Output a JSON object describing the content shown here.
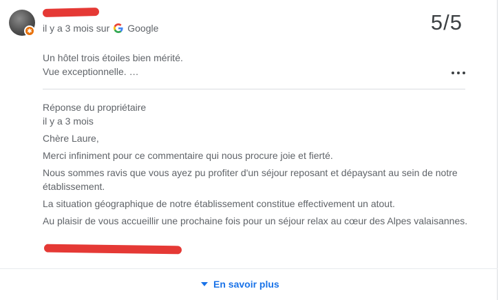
{
  "review": {
    "author_redacted": true,
    "meta": {
      "time": "il y a 3 mois sur",
      "source": "Google",
      "source_icon": "google-g-icon"
    },
    "rating": "5/5",
    "text_lines": [
      "Un hôtel trois étoiles bien mérité.",
      "Vue exceptionnelle. …"
    ],
    "more_icon": "more-horiz-icon"
  },
  "owner_reply": {
    "title": "Réponse du propriétaire",
    "time": "il y a 3 mois",
    "greeting": "Chère Laure,",
    "paragraphs": [
      "Merci infiniment pour ce commentaire qui nous procure joie et fierté.",
      "Nous sommes ravis que vous ayez pu profiter d'un séjour reposant et dépaysant au sein de notre établissement.",
      "La situation géographique de notre établissement constitue effectivement un atout.",
      "Au plaisir de vous accueillir une prochaine fois pour un séjour relax au cœur des Alpes valaisannes."
    ],
    "signature_redacted": true
  },
  "footer": {
    "see_more_label": "En savoir plus",
    "see_more_icon": "caret-down-icon",
    "accent": "#1a73e8"
  },
  "colors": {
    "text": "#5f6368",
    "rating": "#3c4043",
    "redaction": "#e53935",
    "badge": "#e8710a"
  }
}
